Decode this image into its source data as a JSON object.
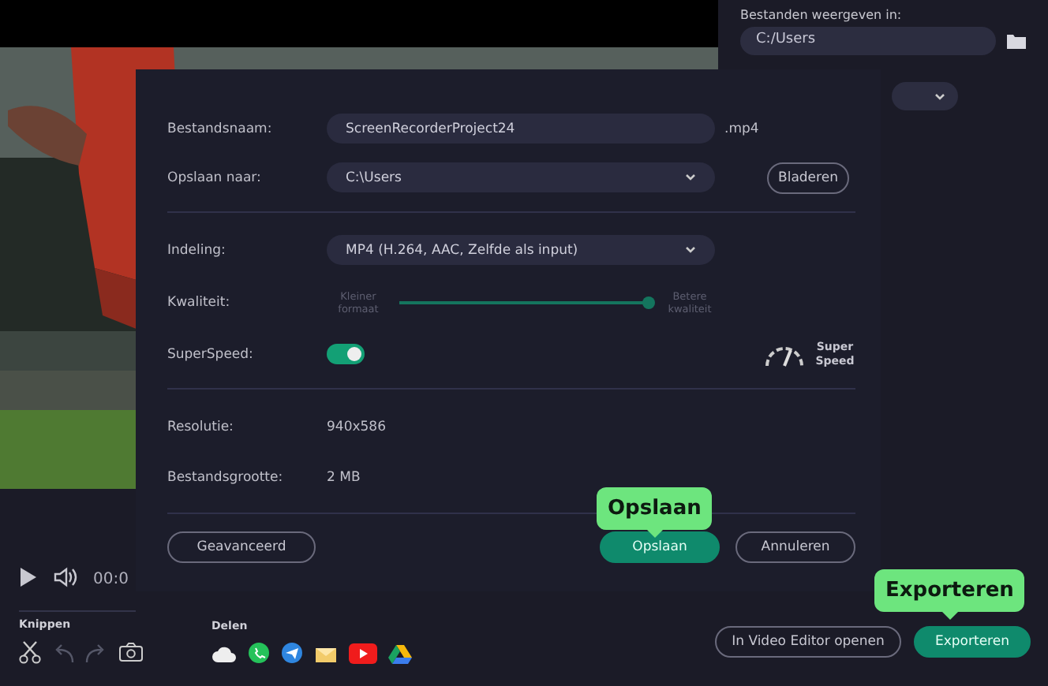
{
  "side_panel": {
    "location_label": "Bestanden weergeven in:",
    "location_value": "C:/Users"
  },
  "player": {
    "time": "00:0"
  },
  "toolbar": {
    "cut_label": "Knippen",
    "share_label": "Delen",
    "buttons": [
      {
        "label": "In Video Editor openen",
        "primary": false
      },
      {
        "label": "Exporteren",
        "primary": true
      }
    ]
  },
  "dialog": {
    "filename_label": "Bestandsnaam:",
    "filename": "ScreenRecorderProject24",
    "extension": ".mp4",
    "save_to_label": "Opslaan naar:",
    "save_to": "C:\\Users",
    "browse": "Bladeren",
    "format_label": "Indeling:",
    "format": "MP4 (H.264, AAC, Zelfde als input)",
    "quality_label": "Kwaliteit:",
    "quality_low": "Kleiner formaat",
    "quality_high": "Betere kwaliteit",
    "quality": {
      "level": 1
    },
    "superspeed_label": "SuperSpeed:",
    "superspeed_on": true,
    "superspeed_badge": "Super Speed",
    "info": [
      {
        "label": "Resolutie:",
        "value": "940x586"
      },
      {
        "label": "Bestandsgrootte:",
        "value": "2 MB"
      }
    ],
    "advanced": "Geavanceerd",
    "buttons": [
      {
        "label": "Opslaan",
        "primary": true
      },
      {
        "label": "Annuleren",
        "primary": false
      }
    ]
  },
  "callouts": [
    {
      "text": "Opslaan"
    },
    {
      "text": "Exporteren"
    }
  ]
}
